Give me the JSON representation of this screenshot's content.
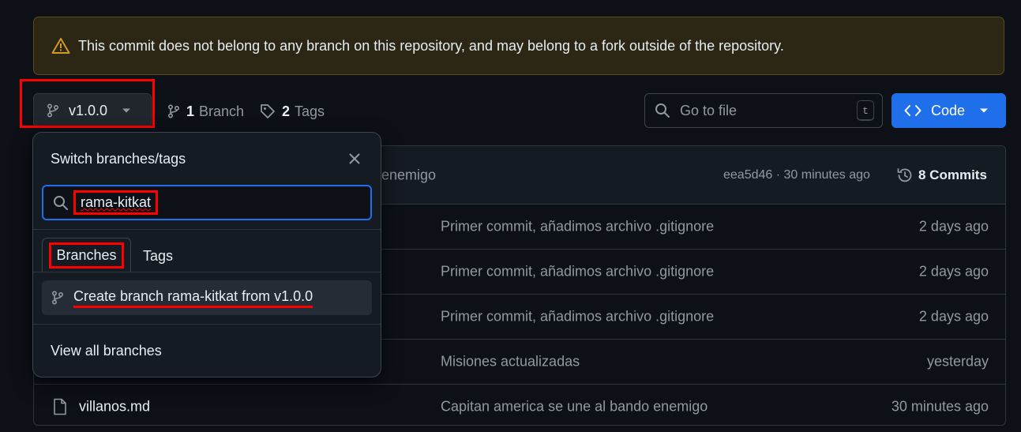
{
  "banner": {
    "text": "This commit does not belong to any branch on this repository, and may belong to a fork outside of the repository.",
    "icon": "alert-icon"
  },
  "toolbar": {
    "branch_name": "v1.0.0",
    "branch_count": "1",
    "branch_label": "Branch",
    "tag_count": "2",
    "tag_label": "Tags",
    "goto_placeholder": "Go to file",
    "goto_shortcut": "t",
    "code_label": "Code"
  },
  "commit_header": {
    "partial_message": "enemigo",
    "meta": "eea5d46 · 30 minutes ago",
    "commits_label": "8 Commits"
  },
  "files": [
    {
      "name": "",
      "message": "Primer commit, añadimos archivo .gitignore",
      "age": "2 days ago"
    },
    {
      "name": "",
      "message": "Primer commit, añadimos archivo .gitignore",
      "age": "2 days ago"
    },
    {
      "name": "",
      "message": "Primer commit, añadimos archivo .gitignore",
      "age": "2 days ago"
    },
    {
      "name": "",
      "message": "Misiones actualizadas",
      "age": "yesterday"
    },
    {
      "name": "villanos.md",
      "message": "Capitan america se une al bando enemigo",
      "age": "30 minutes ago"
    }
  ],
  "dropdown": {
    "title": "Switch branches/tags",
    "search_value": "rama-kitkat",
    "tabs": [
      "Branches",
      "Tags"
    ],
    "create_label": "Create branch rama-kitkat from v1.0.0",
    "view_all": "View all branches"
  },
  "colors": {
    "background": "#0d1117",
    "accent": "#1f6feb",
    "highlight": "#ff0000",
    "warning_bg": "#2c2614"
  }
}
